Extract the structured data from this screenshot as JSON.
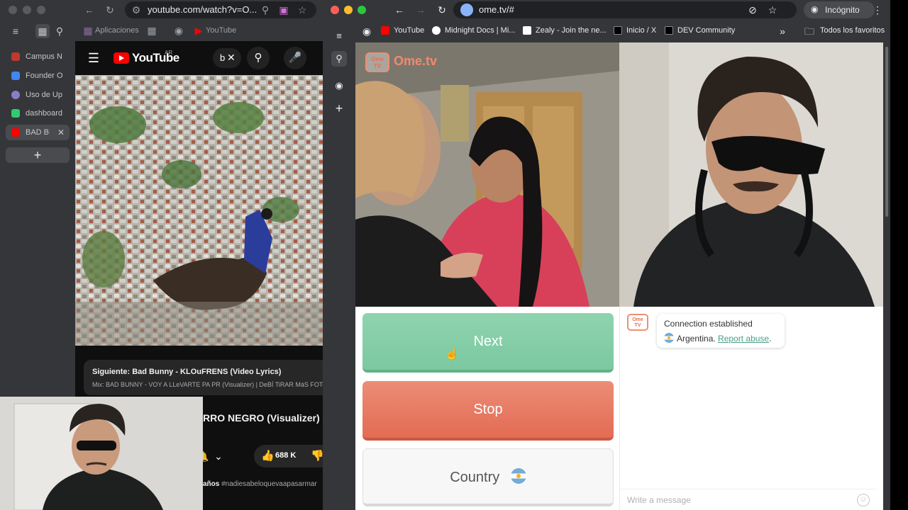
{
  "left_window": {
    "url": "youtube.com/watch?v=O...",
    "bookmarks": [
      "Aplicaciones",
      "YouTube"
    ],
    "sidebar_tabs": [
      {
        "label": "Campus N",
        "color": "#c0392b"
      },
      {
        "label": "Founder O",
        "color": "#4285f4"
      },
      {
        "label": "Uso de Up",
        "color": "#8e7cc3"
      },
      {
        "label": "dashboard",
        "color": "#2ecc71"
      },
      {
        "label": "BAD BU",
        "color": "#ff0000"
      }
    ],
    "youtube": {
      "logo_text": "YouTube",
      "region": "AR",
      "search_value": "b",
      "up_next_title": "Siguiente: Bad Bunny - KLOuFRENS (Video Lyrics)",
      "up_next_subtitle": "Mix: BAD BUNNY - VOY A LLeVARTE PA PR (Visualizer) | DeBÍ TiRAR MáS FOToS",
      "video_title": "RRO NEGRO (Visualizer) |",
      "like_count": "688 K",
      "hashtags_prefix": "años",
      "hashtag": "#nadiesabeloquevaapasarmar"
    }
  },
  "right_window": {
    "url": "ome.tv/#",
    "incognito_label": "Incógnito",
    "bookmarks": [
      {
        "label": "YouTube",
        "color": "#ff0000"
      },
      {
        "label": "Midnight Docs | Mi...",
        "color": "#ffffff"
      },
      {
        "label": "Zealy - Join the ne...",
        "color": "#ffffff"
      },
      {
        "label": "Inicio / X",
        "color": "#ffffff"
      },
      {
        "label": "DEV Community",
        "color": "#ffffff"
      }
    ],
    "all_bookmarks": "Todos los favoritos",
    "ome": {
      "logo_badge": "Ome TV",
      "logo_text": "Ome.tv",
      "next_label": "Next",
      "stop_label": "Stop",
      "country_label": "Country",
      "chat_status": "Connection established",
      "chat_country": "Argentina.",
      "report_label": "Report abuse",
      "message_placeholder": "Write a message"
    }
  },
  "colors": {
    "next_green": "#7cc8a0",
    "stop_red": "#e36b53",
    "ome_orange": "#ef6b4b",
    "report_link": "#4a9f87",
    "youtube_red": "#ff0000"
  }
}
